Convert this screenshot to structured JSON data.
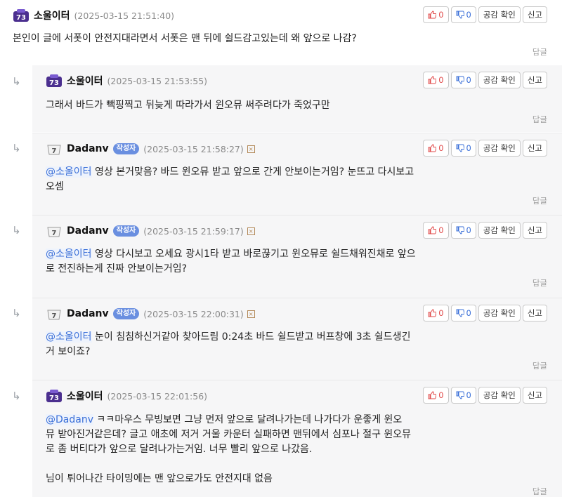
{
  "reply_arrow": "↳",
  "buttons": {
    "empathy": "공감 확인",
    "report": "신고",
    "reply": "답글"
  },
  "comments": [
    {
      "nick": "소울이터",
      "level": "73",
      "time": "(2025-03-15 21:51:40)",
      "likes": "0",
      "dislikes": "0",
      "lines": [
        "본인이 글에 서폿이 안전지대라면서 서폿은 맨 뒤에 쉴드감고있는데 왜 앞으로 나감?"
      ]
    },
    {
      "nick": "소울이터",
      "level": "73",
      "time": "(2025-03-15 21:53:55)",
      "likes": "0",
      "dislikes": "0",
      "lines": [
        "그래서 바드가 빽핑찍고 뒤늦게 따라가서 윈오뮤 써주려다가 죽었구만"
      ]
    },
    {
      "nick": "Dadanv",
      "level": "7",
      "badge": "작성자",
      "time": "(2025-03-15 21:58:27)",
      "likes": "0",
      "dislikes": "0",
      "mention": "@소울이터",
      "lines": [
        " 영상 본거맞음? 바드 윈오뮤 받고 앞으로 간게 안보이는거임? 눈뜨고 다시보고",
        "오셈"
      ]
    },
    {
      "nick": "Dadanv",
      "level": "7",
      "badge": "작성자",
      "time": "(2025-03-15 21:59:17)",
      "likes": "0",
      "dislikes": "0",
      "mention": "@소울이터",
      "lines": [
        " 영상 다시보고 오세요 광시1타 받고 바로끊기고 윈오뮤로 쉴드채워진채로 앞으",
        "로 전진하는게 진짜 안보이는거임?"
      ]
    },
    {
      "nick": "Dadanv",
      "level": "7",
      "badge": "작성자",
      "time": "(2025-03-15 22:00:31)",
      "likes": "0",
      "dislikes": "0",
      "mention": "@소울이터",
      "lines": [
        " 눈이 침침하신거같아 찾아드림 0:24초 바드 쉴드받고 버프창에 3초 쉴드생긴",
        "거 보이죠?"
      ]
    },
    {
      "nick": "소울이터",
      "level": "73",
      "time": "(2025-03-15 22:01:56)",
      "likes": "0",
      "dislikes": "0",
      "mention": "@Dadanv",
      "lines": [
        " ㅋㅋ마우스 무빙보면 그냥 먼저 앞으로 달려나가는데 나가다가 운좋게 윈오",
        "뮤 받아진거같은데? 글고 애초에 저거 거울 카운터 실패하면 맨뒤에서 심포나 절구 윈오뮤",
        "로 좀 버티다가 앞으로 달려나가는거임. 너무 빨리 앞으로 나갔음.",
        "",
        "님이 튀어나간 타이밍에는 맨 앞으로가도 안전지대 없음"
      ]
    }
  ]
}
